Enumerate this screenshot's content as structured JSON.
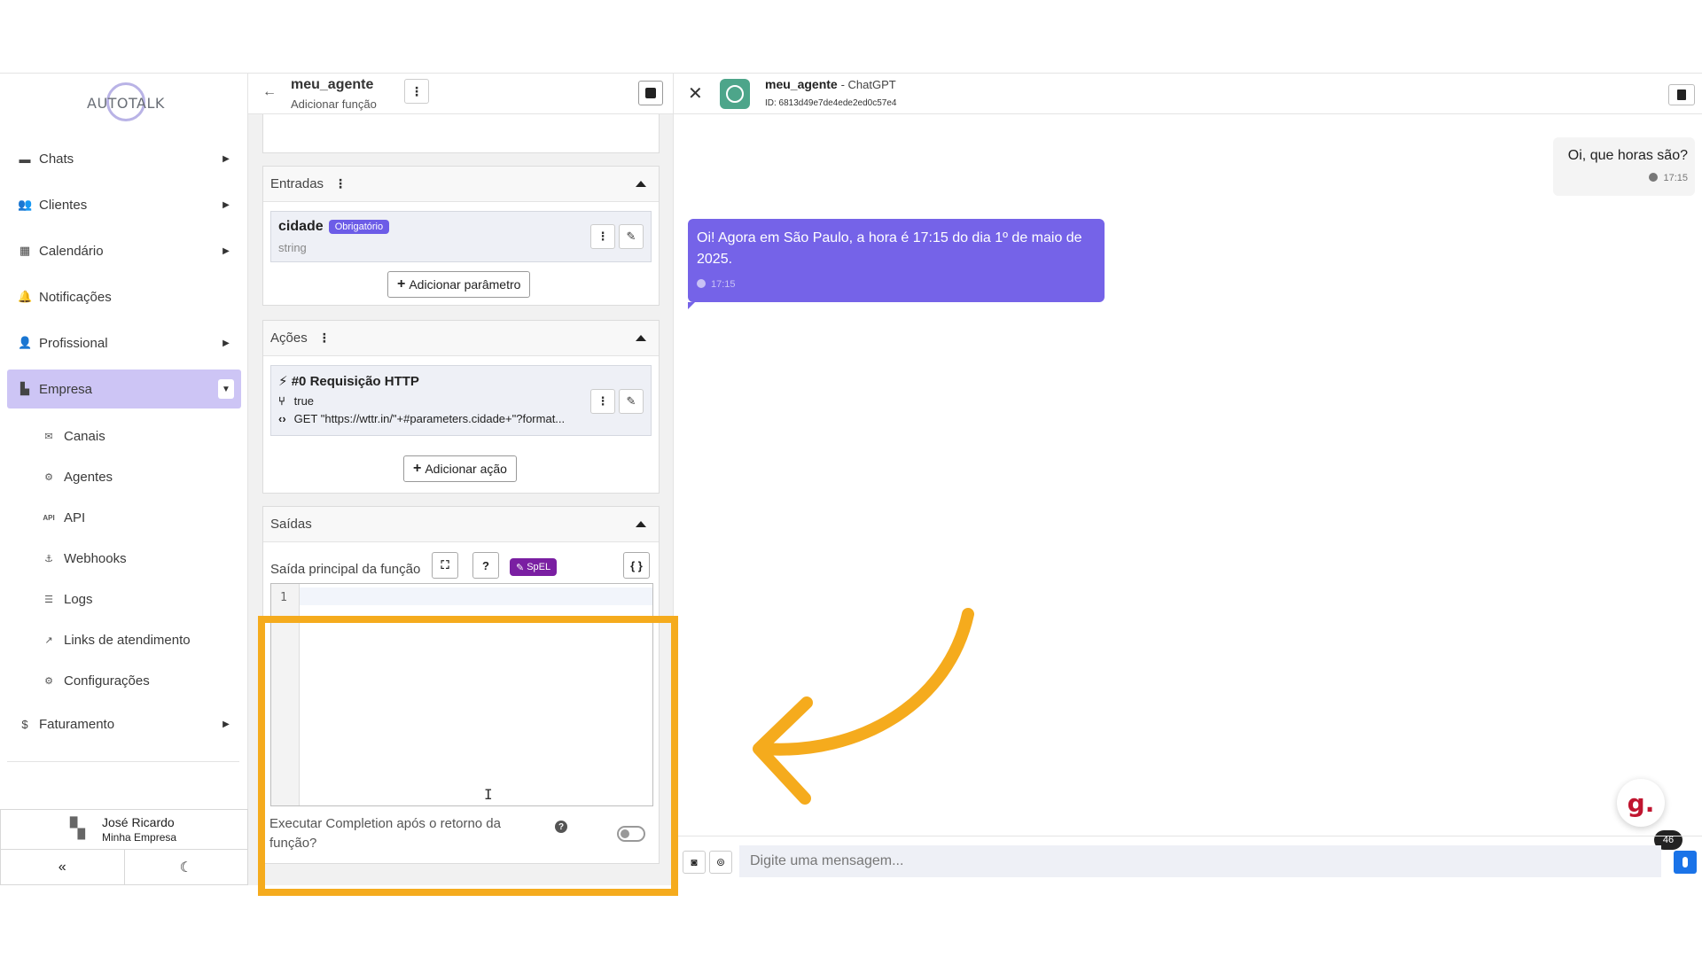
{
  "sidebar": {
    "logo_text": "AUTOTALK",
    "nav": [
      {
        "label": "Chats",
        "icon": "chat-icon"
      },
      {
        "label": "Clientes",
        "icon": "users-icon"
      },
      {
        "label": "Calendário",
        "icon": "calendar-icon"
      },
      {
        "label": "Notificações",
        "icon": "bell-icon"
      },
      {
        "label": "Profissional",
        "icon": "professional-icon"
      },
      {
        "label": "Empresa",
        "icon": "building-icon"
      }
    ],
    "sub": [
      {
        "label": "Canais",
        "icon": "channel-icon"
      },
      {
        "label": "Agentes",
        "icon": "robot-icon"
      },
      {
        "label": "API",
        "icon": "api-icon"
      },
      {
        "label": "Webhooks",
        "icon": "webhook-icon"
      },
      {
        "label": "Logs",
        "icon": "list-icon"
      },
      {
        "label": "Links de atendimento",
        "icon": "external-link-icon"
      },
      {
        "label": "Configurações",
        "icon": "gear-icon"
      }
    ],
    "billing": {
      "label": "Faturamento",
      "icon": "dollar-icon"
    },
    "user": {
      "name": "José Ricardo",
      "company": "Minha Empresa"
    }
  },
  "function_editor": {
    "agent_name": "meu_agente",
    "subtitle": "Adicionar função",
    "inputs": {
      "title": "Entradas",
      "param": {
        "name": "cidade",
        "badge": "Obrigatório",
        "type": "string"
      },
      "add_label": "Adicionar parâmetro"
    },
    "actions": {
      "title": "Ações",
      "action": {
        "title": "#0 Requisição HTTP",
        "condition": "true",
        "request": "GET \"https://wttr.in/\"+#parameters.cidade+\"?format..."
      },
      "add_label": "Adicionar ação"
    },
    "outputs": {
      "title": "Saídas",
      "main_label": "Saída principal da função",
      "help": "?",
      "spel": "SpEL",
      "code_btn": "{ }",
      "line_number": "1",
      "completion_label": "Executar Completion após o retorno da função?"
    }
  },
  "chat": {
    "agent_name": "meu_agente",
    "model": "ChatGPT",
    "agent_id": "ID: 6813d49e7de4ede2ed0c57e4",
    "messages": [
      {
        "from": "user",
        "text": "Oi, que horas são?",
        "time": "17:15"
      },
      {
        "from": "bot",
        "text": "Oi! Agora em São Paulo, a hora é 17:15 do dia 1º de maio de 2025.",
        "time": "17:15"
      }
    ],
    "input_placeholder": "Digite uma mensagem...",
    "widget_letter": "g.",
    "widget_count": "46"
  },
  "colors": {
    "accent": "#7563e8",
    "highlight": "#f5ab1d",
    "active_nav": "#cdc5f5"
  }
}
